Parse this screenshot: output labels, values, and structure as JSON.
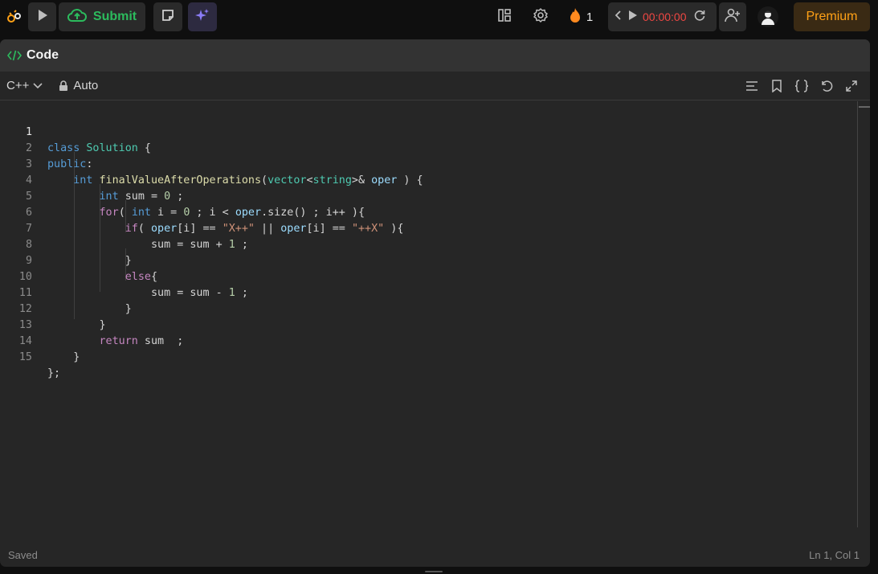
{
  "topbar": {
    "submit_label": "Submit",
    "streak_count": "1",
    "timer": "00:00:00",
    "premium_label": "Premium"
  },
  "panel": {
    "title": "Code",
    "language": "C++",
    "mode": "Auto"
  },
  "editor": {
    "active_line": 1,
    "lines": [
      "class Solution {",
      "public:",
      "    int finalValueAfterOperations(vector<string>& oper ) {",
      "        int sum = 0 ;",
      "        for( int i = 0 ; i < oper.size() ; i++ ){",
      "            if( oper[i] == \"X++\" || oper[i] == \"++X\" ){",
      "                sum = sum + 1 ;",
      "            }",
      "            else{",
      "                sum = sum - 1 ;",
      "            }",
      "        }",
      "        return sum  ;",
      "    }",
      "};"
    ],
    "line_numbers": [
      "1",
      "2",
      "3",
      "4",
      "5",
      "6",
      "7",
      "8",
      "9",
      "10",
      "11",
      "12",
      "13",
      "14",
      "15"
    ]
  },
  "status": {
    "left": "Saved",
    "right": "Ln 1, Col 1"
  },
  "colors": {
    "submit_green": "#2cbb5d",
    "timer_red": "#ef4743",
    "premium_orange": "#ffa116",
    "ai_purple": "#8b7cf6",
    "flame": "#ff8a1f"
  },
  "icons": [
    "leetcode-logo-icon",
    "run-icon",
    "cloud-upload-icon",
    "notes-icon",
    "sparkle-icon",
    "layout-icon",
    "settings-icon",
    "fire-icon",
    "chevron-left-icon",
    "play-icon",
    "reset-icon",
    "add-user-icon",
    "avatar",
    "code-brackets-icon",
    "chevron-down-icon",
    "lock-icon",
    "format-icon",
    "bookmark-icon",
    "braces-icon",
    "undo-icon",
    "expand-icon"
  ]
}
